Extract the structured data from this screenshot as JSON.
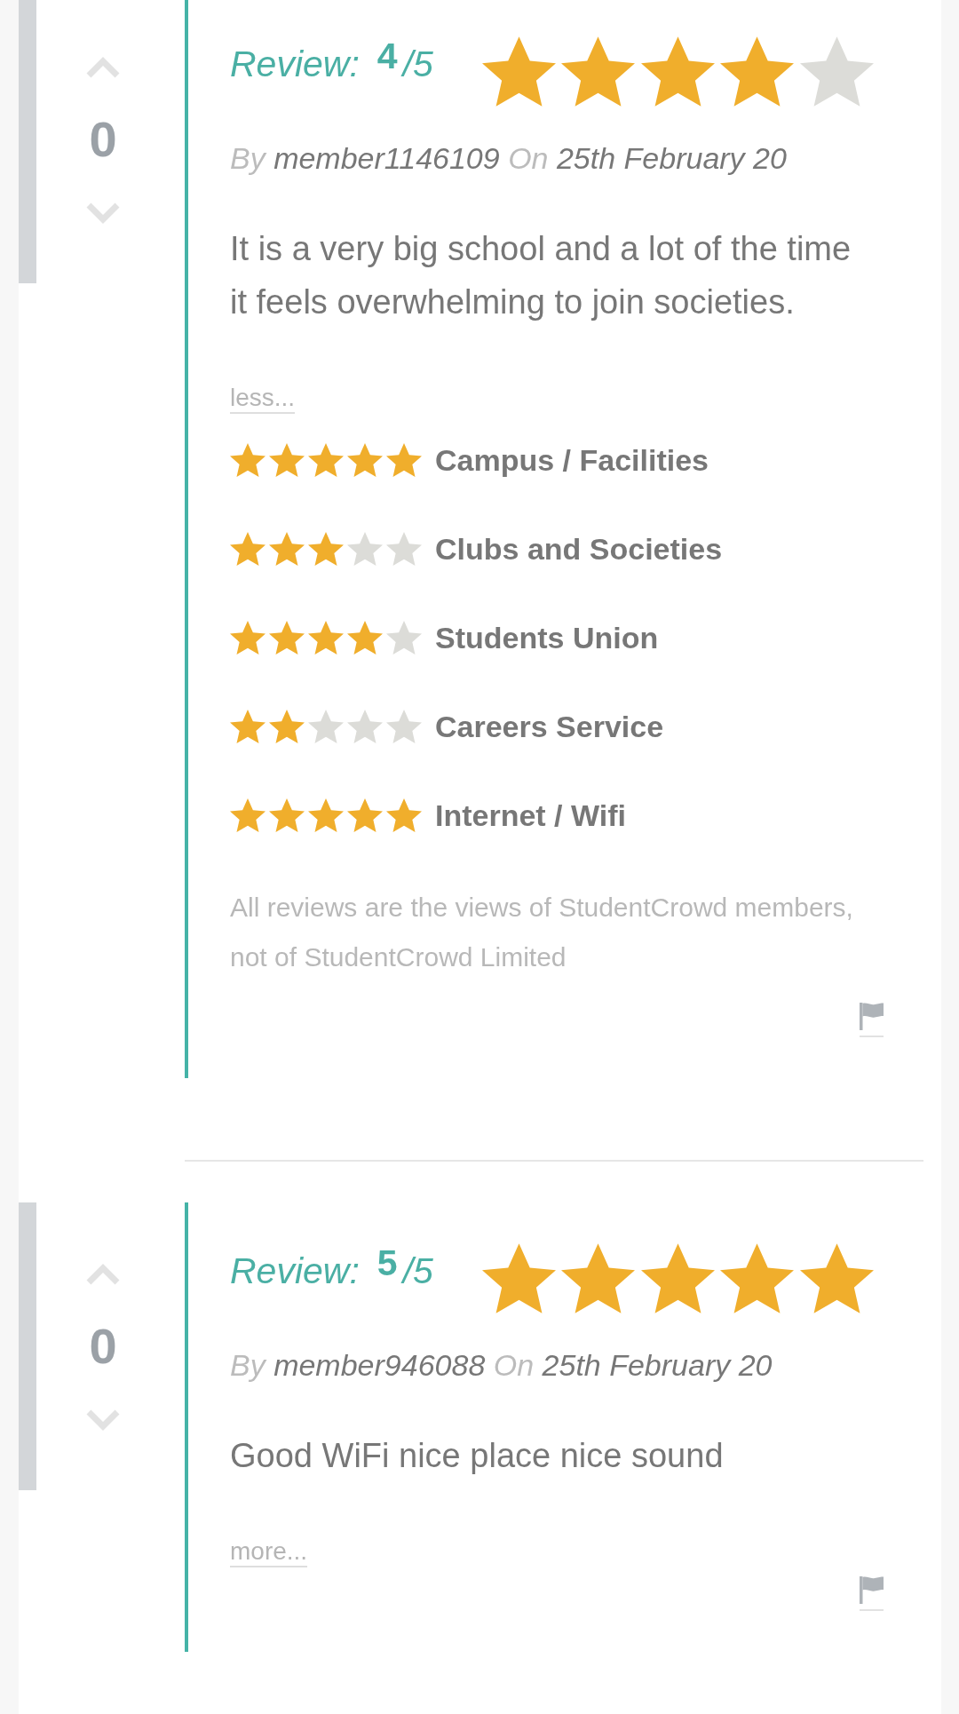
{
  "reviews": [
    {
      "votes": "0",
      "label": "Review:",
      "score": "$^{4}$/5",
      "stars": 4,
      "by_label": "By",
      "author": "member1146109",
      "on_label": "On",
      "date": "25th February 20",
      "body": "It is a very big school and a lot of the time it feels overwhelming to join societies.",
      "toggle": "less...",
      "ratings": [
        {
          "label": "Campus / Facilities",
          "stars": 5
        },
        {
          "label": "Clubs and Societies",
          "stars": 3
        },
        {
          "label": "Students Union",
          "stars": 4
        },
        {
          "label": "Careers Service",
          "stars": 2
        },
        {
          "label": "Internet / Wifi",
          "stars": 5
        }
      ],
      "disclaimer": "All reviews are the views of StudentCrowd members, not of StudentCrowd Limited"
    },
    {
      "votes": "0",
      "label": "Review:",
      "score": "$^{5}$/5",
      "stars": 5,
      "by_label": "By",
      "author": "member946088",
      "on_label": "On",
      "date": "25th February 20",
      "body": "Good WiFi nice place nice sound",
      "toggle": "more..."
    }
  ]
}
